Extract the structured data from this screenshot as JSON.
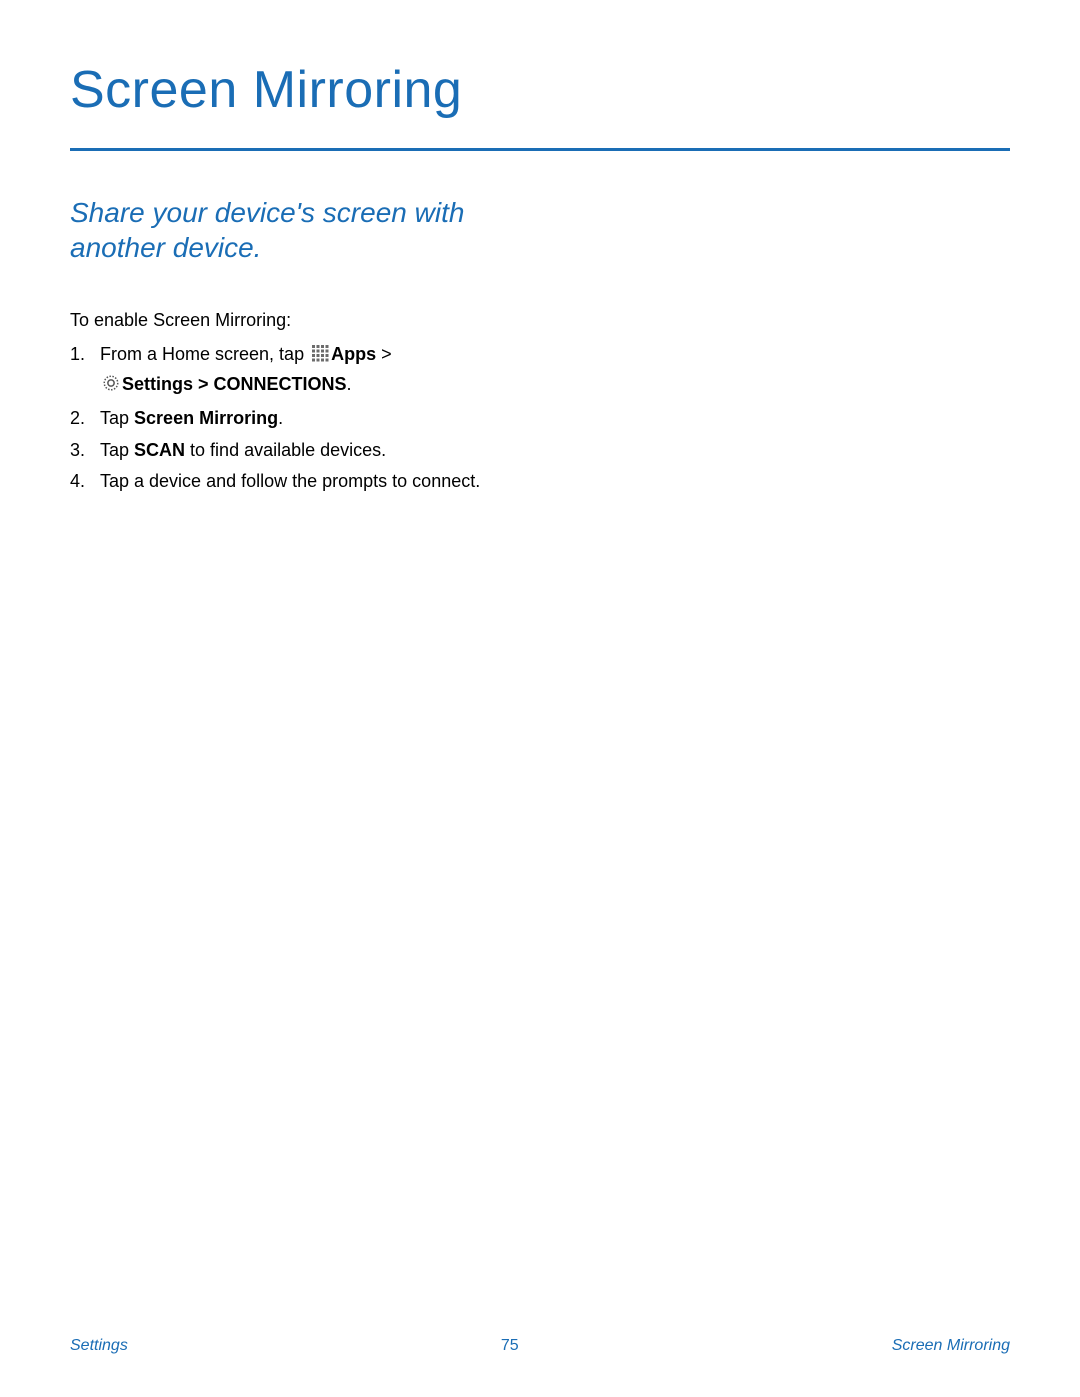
{
  "title": "Screen Mirroring",
  "subtitle": "Share your device's screen with another device.",
  "intro": "To enable Screen Mirroring:",
  "steps": {
    "s1": {
      "t1": "From a Home screen, tap ",
      "apps": "Apps",
      "gt": "  > ",
      "settings": "Settings",
      "mid": " > ",
      "conn": "CONNECTIONS",
      "end": "."
    },
    "s2": {
      "t1": "Tap ",
      "bold": "Screen Mirroring",
      "end": "."
    },
    "s3": {
      "t1": "Tap ",
      "bold": "SCAN",
      "t2": " to find available devices."
    },
    "s4": {
      "t1": "Tap a device and follow the prompts to connect."
    }
  },
  "footer": {
    "left": "Settings",
    "center": "75",
    "right": "Screen Mirroring"
  }
}
